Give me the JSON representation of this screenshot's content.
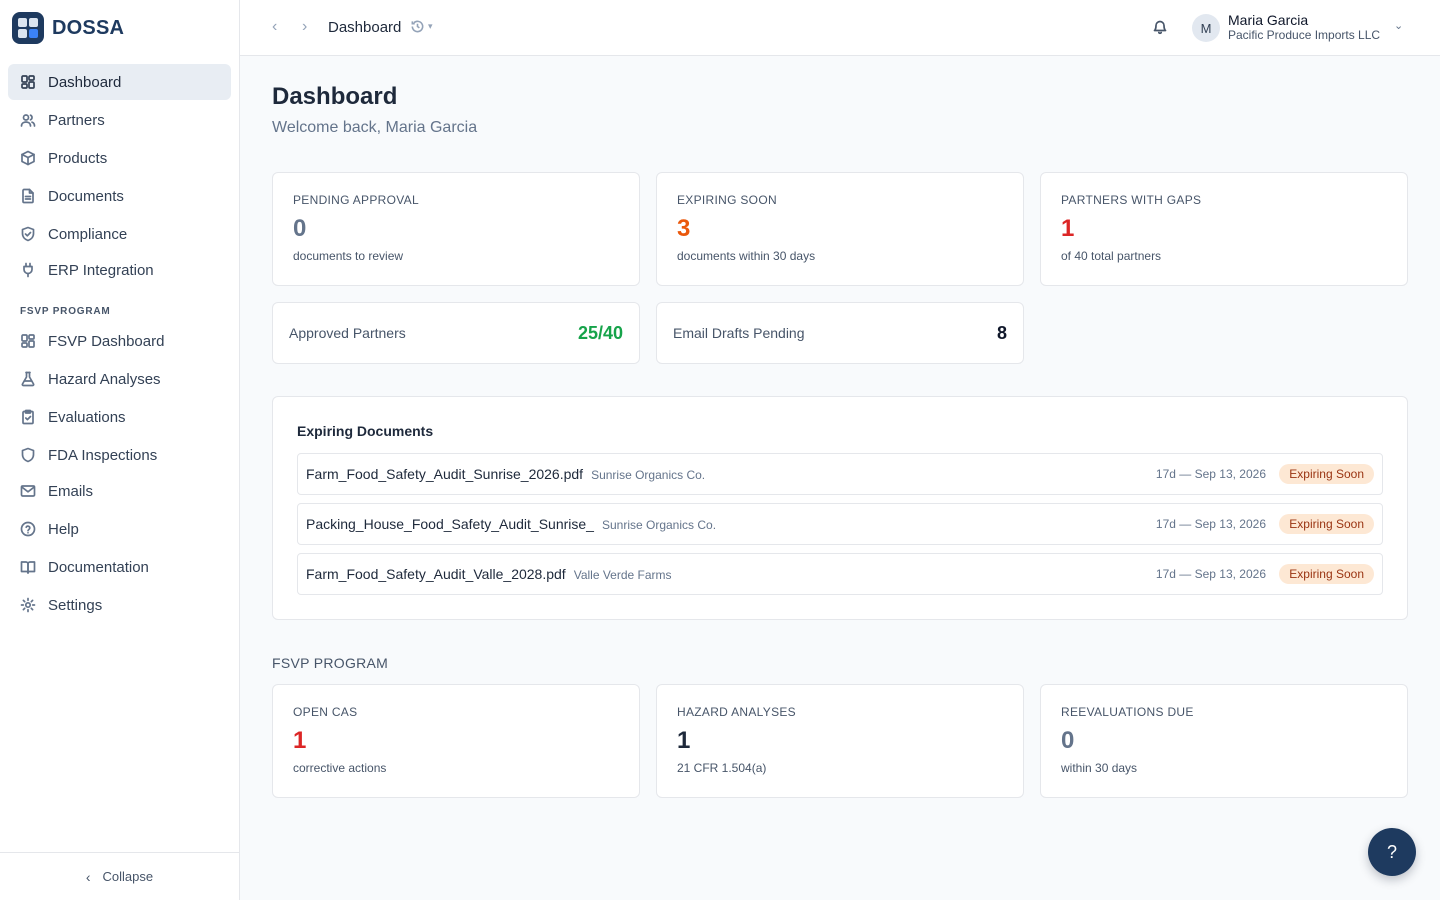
{
  "brand": {
    "name": "DOSSA"
  },
  "sidebar": {
    "items": [
      {
        "label": "Dashboard",
        "icon": "grid-icon",
        "active": true
      },
      {
        "label": "Partners",
        "icon": "users-icon"
      },
      {
        "label": "Products",
        "icon": "box-icon"
      },
      {
        "label": "Documents",
        "icon": "file-icon"
      },
      {
        "label": "Compliance",
        "icon": "shield-check-icon"
      },
      {
        "label": "ERP Integration",
        "icon": "plug-icon"
      },
      {
        "label": "FSVP Dashboard",
        "icon": "grid-icon"
      },
      {
        "label": "Hazard Analyses",
        "icon": "flask-icon"
      },
      {
        "label": "Evaluations",
        "icon": "clipboard-check-icon"
      },
      {
        "label": "FDA Inspections",
        "icon": "shield-icon"
      },
      {
        "label": "Emails",
        "icon": "mail-icon"
      },
      {
        "label": "Help",
        "icon": "help-circle-icon"
      },
      {
        "label": "Documentation",
        "icon": "book-icon"
      },
      {
        "label": "Settings",
        "icon": "gear-icon"
      }
    ],
    "section_label": "FSVP PROGRAM",
    "collapse_label": "Collapse"
  },
  "topbar": {
    "breadcrumb": "Dashboard",
    "user": {
      "initial": "M",
      "name": "Maria Garcia",
      "org": "Pacific Produce Imports LLC"
    }
  },
  "main": {
    "title": "Dashboard",
    "welcome": "Welcome back, Maria Garcia",
    "stats": [
      {
        "label": "PENDING APPROVAL",
        "value": "0",
        "sub": "documents to review",
        "color": "#64748b"
      },
      {
        "label": "EXPIRING SOON",
        "value": "3",
        "sub": "documents within 30 days",
        "color": "#ea580c"
      },
      {
        "label": "PARTNERS WITH GAPS",
        "value": "1",
        "sub": "of 40 total partners",
        "color": "#dc2626"
      }
    ],
    "mini": [
      {
        "label": "Approved Partners",
        "value": "25/40",
        "color": "#16a34a"
      },
      {
        "label": "Email Drafts Pending",
        "value": "8",
        "color": "#0f172a"
      }
    ],
    "expiring": {
      "title": "Expiring Documents",
      "rows": [
        {
          "file": "Farm_Food_Safety_Audit_Sunrise_2026.pdf",
          "partner": "Sunrise Organics Co.",
          "when": "17d — Sep 13, 2026",
          "badge": "Expiring Soon"
        },
        {
          "file": "Packing_House_Food_Safety_Audit_Sunrise_",
          "partner": "Sunrise Organics Co.",
          "when": "17d — Sep 13, 2026",
          "badge": "Expiring Soon"
        },
        {
          "file": "Farm_Food_Safety_Audit_Valle_2028.pdf",
          "partner": "Valle Verde Farms",
          "when": "17d — Sep 13, 2026",
          "badge": "Expiring Soon"
        }
      ]
    },
    "fsvp": {
      "title": "FSVP PROGRAM",
      "stats": [
        {
          "label": "OPEN CAS",
          "value": "1",
          "sub": "corrective actions",
          "color": "#dc2626"
        },
        {
          "label": "HAZARD ANALYSES",
          "value": "1",
          "sub": "21 CFR 1.504(a)",
          "color": "#1e293b"
        },
        {
          "label": "REEVALUATIONS DUE",
          "value": "0",
          "sub": "within 30 days",
          "color": "#64748b"
        }
      ]
    }
  },
  "help_button": {
    "label": "?"
  },
  "colors": {
    "brand": "#1e3a5f",
    "badge_bg": "#fde8d4",
    "badge_text": "#9a3412"
  }
}
